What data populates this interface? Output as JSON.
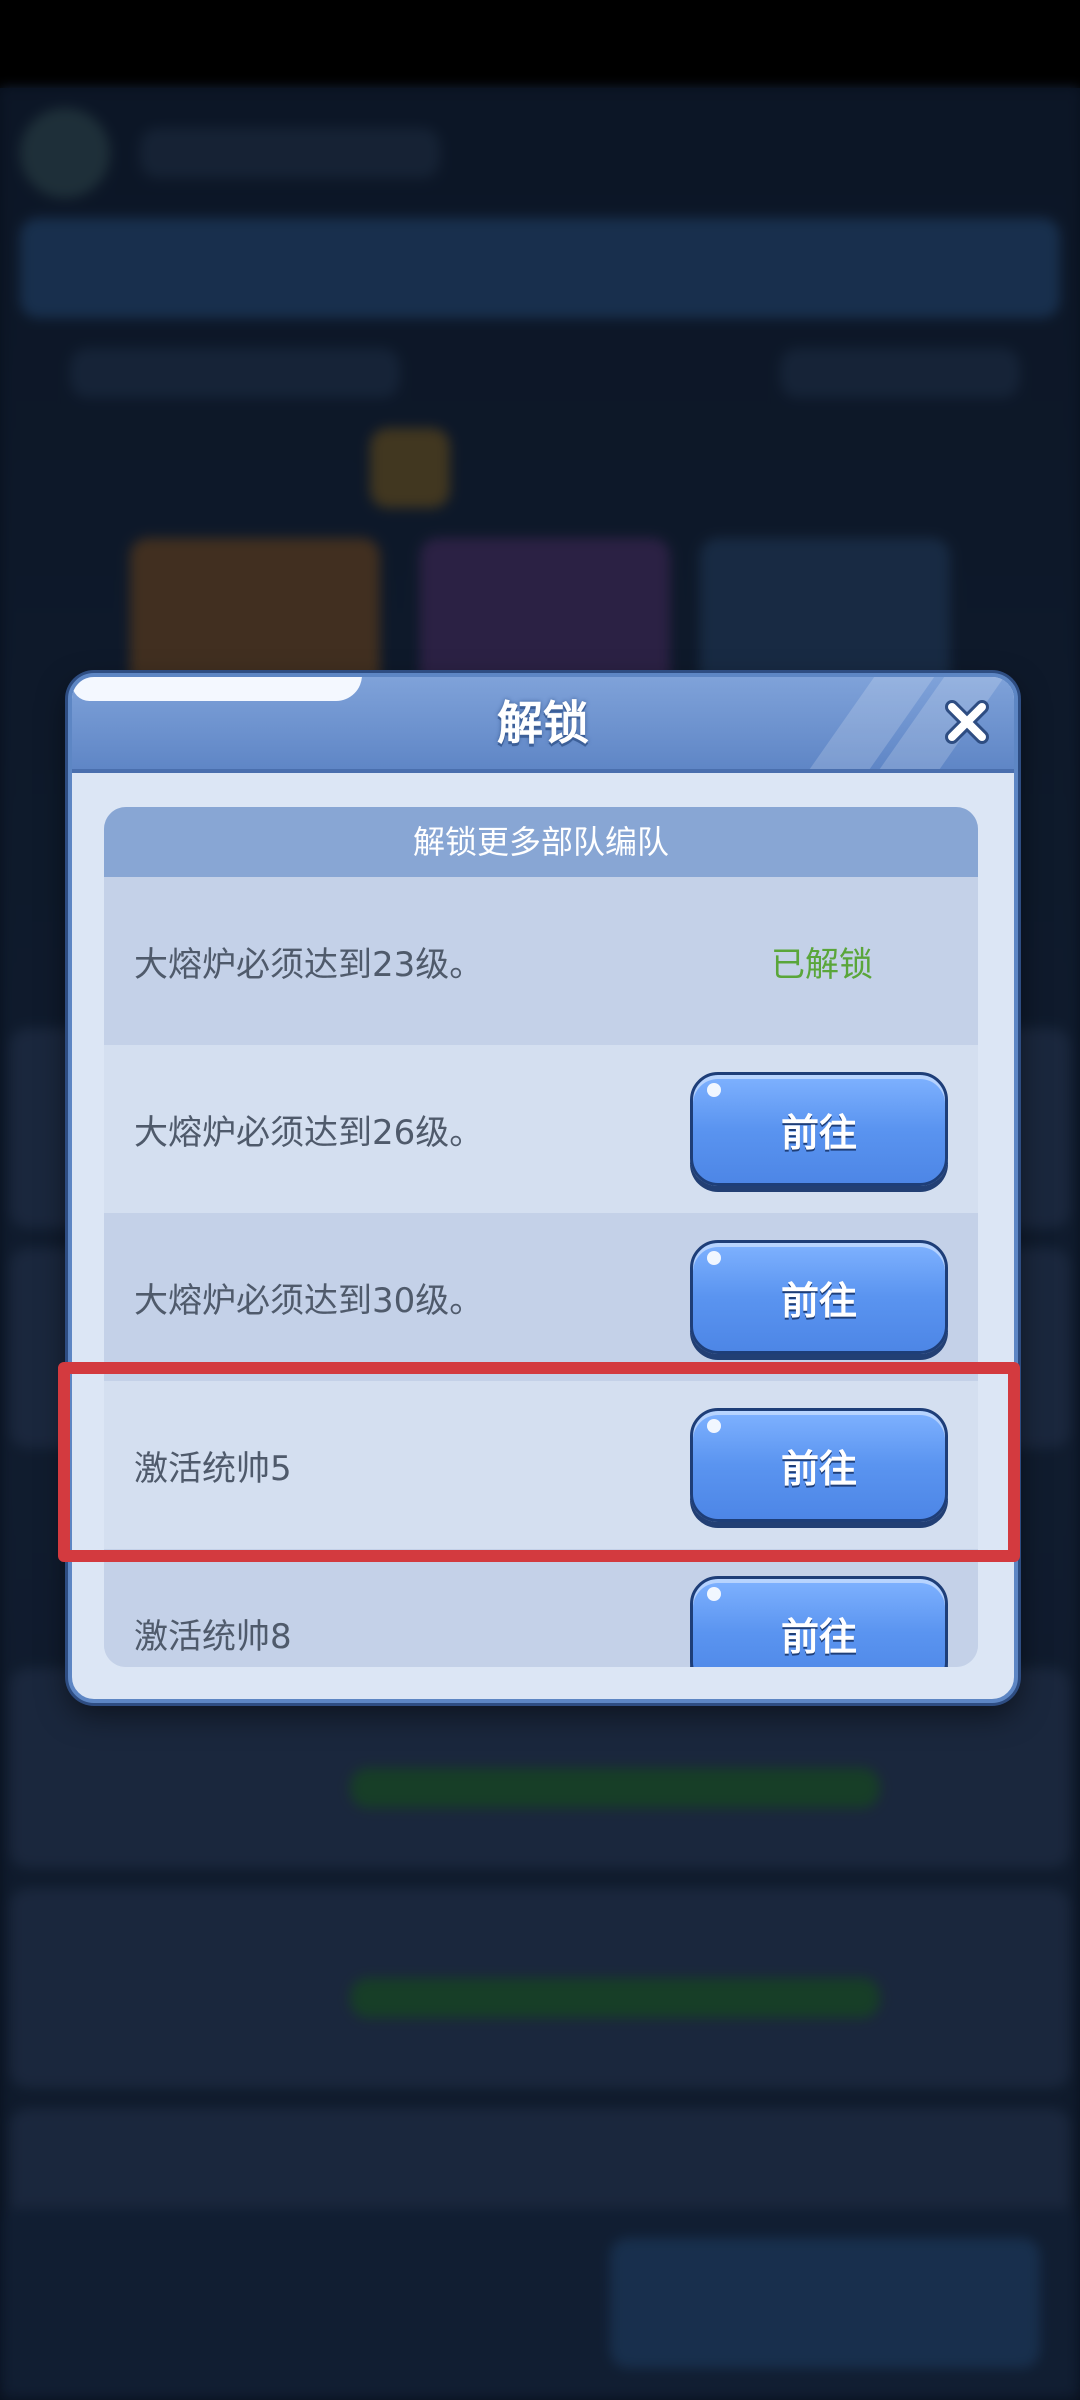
{
  "dialog": {
    "title": "解锁",
    "list_header": "解锁更多部队编队",
    "rows": [
      {
        "requirement": "大熔炉必须达到23级。",
        "status": "已解锁",
        "action": ""
      },
      {
        "requirement": "大熔炉必须达到26级。",
        "status": "",
        "action": "前往"
      },
      {
        "requirement": "大熔炉必须达到30级。",
        "status": "",
        "action": "前往"
      },
      {
        "requirement": "激活统帅5",
        "status": "",
        "action": "前往"
      },
      {
        "requirement": "激活统帅8",
        "status": "",
        "action": "前往"
      }
    ]
  },
  "colors": {
    "highlight": "#d33a3f",
    "unlocked_text": "#5aa63a",
    "button": "#5a94f0"
  }
}
